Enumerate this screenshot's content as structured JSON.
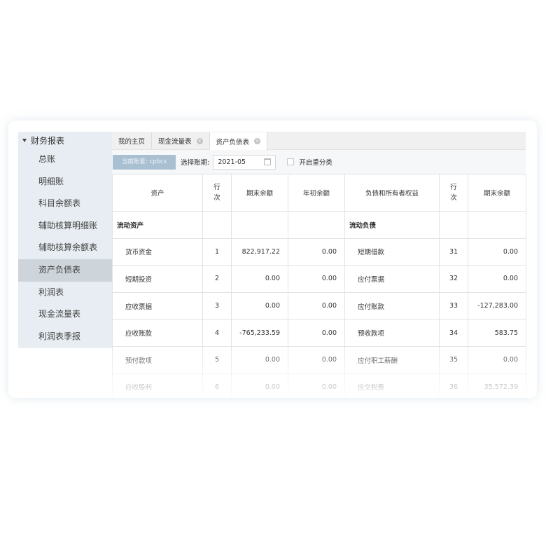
{
  "sidebar": {
    "header": "财务报表",
    "items": [
      {
        "label": "总账"
      },
      {
        "label": "明细账"
      },
      {
        "label": "科目余额表"
      },
      {
        "label": "辅助核算明细账"
      },
      {
        "label": "辅助核算余额表"
      },
      {
        "label": "资产负债表"
      },
      {
        "label": "利润表"
      },
      {
        "label": "现金流量表"
      },
      {
        "label": "利润表季报"
      }
    ],
    "active_item": "资产负债表"
  },
  "tabs": [
    {
      "label": "我的主页"
    },
    {
      "label": "现金流量表"
    },
    {
      "label": "资产负债表"
    }
  ],
  "active_tab": "资产负债表",
  "toolbar": {
    "account_button": "当前账套: cpbcs",
    "period_label": "选择账期:",
    "period_value": "2021-05",
    "reclassify_label": "开启重分类",
    "reclassify_checked": false
  },
  "table": {
    "headers": {
      "asset": "资产",
      "row_no_1": "行",
      "row_no_2": "次",
      "end_balance": "期末余额",
      "begin_balance": "年初余额",
      "liab": "负债和所有者权益",
      "row_no_b_1": "行",
      "row_no_b_2": "次",
      "end_balance_b": "期末余额"
    },
    "rows": [
      {
        "asset": "流动资产",
        "no": "",
        "end": "",
        "begin": "",
        "liab": "流动负债",
        "no2": "",
        "end2": "",
        "section": true
      },
      {
        "asset": "货币资金",
        "no": "1",
        "end": "822,917.22",
        "begin": "0.00",
        "liab": "短期借款",
        "no2": "31",
        "end2": "0.00"
      },
      {
        "asset": "短期投资",
        "no": "2",
        "end": "0.00",
        "begin": "0.00",
        "liab": "应付票据",
        "no2": "32",
        "end2": "0.00"
      },
      {
        "asset": "应收票据",
        "no": "3",
        "end": "0.00",
        "begin": "0.00",
        "liab": "应付账款",
        "no2": "33",
        "end2": "-127,283.00"
      },
      {
        "asset": "应收账款",
        "no": "4",
        "end": "-765,233.59",
        "begin": "0.00",
        "liab": "预收款项",
        "no2": "34",
        "end2": "583.75"
      },
      {
        "asset": "预付款项",
        "no": "5",
        "end": "0.00",
        "begin": "0.00",
        "liab": "应付职工薪酬",
        "no2": "35",
        "end2": "0.00"
      },
      {
        "asset": "应收股利",
        "no": "6",
        "end": "0.00",
        "begin": "0.00",
        "liab": "应交税费",
        "no2": "36",
        "end2": "35,572.39"
      }
    ]
  }
}
